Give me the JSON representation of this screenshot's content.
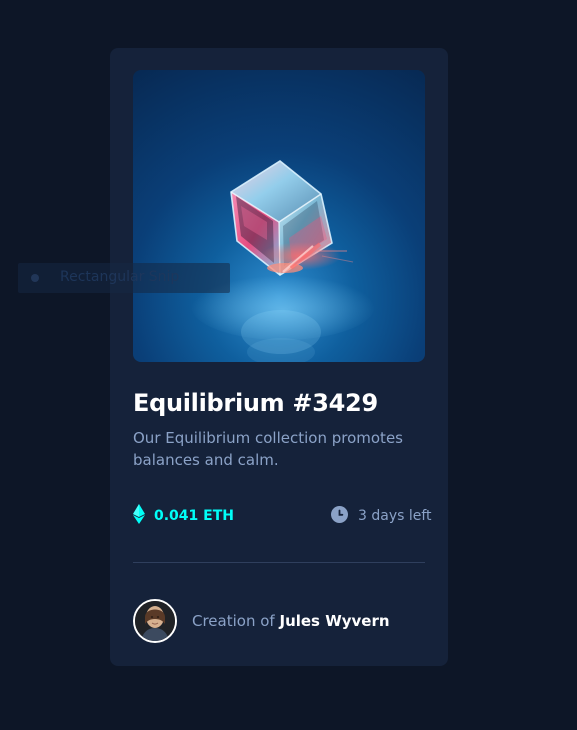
{
  "overlay": {
    "label": "Rectangular Snip",
    "icon": "snip-icon"
  },
  "card": {
    "image_icon": "crystal-cube-image",
    "title": "Equilibrium #3429",
    "description": "Our Equilibrium collection promotes balances and calm.",
    "price": {
      "icon": "ethereum-icon",
      "label": "0.041 ETH"
    },
    "time": {
      "icon": "clock-icon",
      "label": "3 days left"
    },
    "creator": {
      "avatar_icon": "avatar",
      "prefix": "Creation of",
      "name": "Jules Wyvern"
    }
  },
  "colors": {
    "background": "#0d1627",
    "card": "#15223a",
    "accent": "#00fff8",
    "muted": "#8ba2c7",
    "white": "#ffffff",
    "divider": "#2f3f5d"
  }
}
